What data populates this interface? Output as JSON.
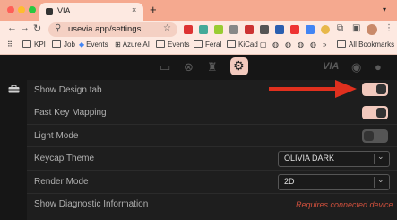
{
  "browser": {
    "tab_title": "VIA",
    "tab_close": "×",
    "new_tab": "+",
    "url": "usevia.app/settings",
    "bookmarks": [
      "KPI",
      "Job",
      "Events",
      "Azure AI",
      "Events",
      "Feral",
      "KiCad"
    ],
    "all_bookmarks": "All Bookmarks",
    "icons": [
      "back-icon",
      "forward-icon",
      "reload-icon",
      "site-info-icon",
      "star-icon",
      "extensions-icon",
      "profile-icon",
      "menu-icon"
    ]
  },
  "app": {
    "nav_icons": [
      "keyboard-icon",
      "debug-icon",
      "design-icon",
      "settings-icon",
      "via-logo",
      "discord-icon",
      "github-icon"
    ],
    "via_logo_text": "VIA",
    "settings": [
      {
        "label": "Show Design tab",
        "control": "toggle",
        "value": "on"
      },
      {
        "label": "Fast Key Mapping",
        "control": "toggle",
        "value": "on"
      },
      {
        "label": "Light Mode",
        "control": "toggle",
        "value": "off"
      },
      {
        "label": "Keycap Theme",
        "control": "select",
        "value": "OLIVIA DARK"
      },
      {
        "label": "Render Mode",
        "control": "select",
        "value": "2D"
      },
      {
        "label": "Show Diagnostic Information",
        "control": "text",
        "value": "Requires connected device"
      }
    ]
  },
  "colors": {
    "accent": "#f2c9bd",
    "tab_strip": "#f5a98f",
    "toolbar": "#fde9e1",
    "background": "#1e1e1e",
    "toggle_off": "#555555",
    "warning": "#d0503d",
    "annotation_arrow": "#e0301e"
  }
}
